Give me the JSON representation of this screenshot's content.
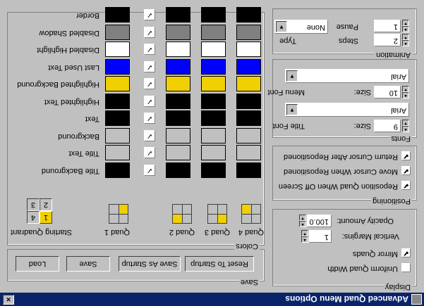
{
  "window": {
    "title": "Advanced Quad Menu Options",
    "close_label": "×"
  },
  "display": {
    "legend": "Display",
    "uniform_quad_width": {
      "label": "Uniform Quad Width",
      "checked": false
    },
    "mirror_quads": {
      "label": "Mirror Quads",
      "checked": true
    },
    "vertical_margins": {
      "label": "Vertical Margins:",
      "value": "1"
    },
    "opacity_amount": {
      "label": "Opacity Amount:",
      "value": "100.0"
    }
  },
  "positioning": {
    "legend": "Positioning",
    "items": [
      {
        "label": "Reposition Quad When Off Screen",
        "checked": true
      },
      {
        "label": "Move Cursor When Repositioned",
        "checked": true
      },
      {
        "label": "Return Cursor After Repositioned",
        "checked": true
      }
    ]
  },
  "fonts": {
    "legend": "Fonts",
    "title_font": {
      "label": "Title Font",
      "value": "Arial",
      "size_label": "Size:",
      "size": "9"
    },
    "menu_font": {
      "label": "Menu Font",
      "value": "Arial",
      "size_label": "Size:",
      "size": "10"
    }
  },
  "animation": {
    "legend": "Animation",
    "type": {
      "label": "Type",
      "value": "None"
    },
    "steps": {
      "label": "Steps",
      "value": "2"
    },
    "pause": {
      "label": "Pause",
      "value": "1"
    }
  },
  "save": {
    "legend": "Save",
    "buttons": [
      "Load",
      "Save",
      "Save As Startup",
      "Reset To Startup"
    ]
  },
  "colors": {
    "legend": "Colors",
    "starting_quadrant_label": "Starting Quadrant",
    "quadrant_numbers": [
      "4",
      "1",
      "3",
      "2"
    ],
    "selected_quadrant": "1",
    "quad_labels": [
      "Quad 1",
      "Quad 2",
      "Quad 3",
      "Quad 4"
    ],
    "rows": [
      {
        "label": "Title Background",
        "swatch_color": "#000000",
        "checked": true
      },
      {
        "label": "Title Text",
        "swatch_color": "#c0c0c0",
        "checked": true
      },
      {
        "label": "Background",
        "swatch_color": "#c0c0c0",
        "checked": true
      },
      {
        "label": "Text",
        "swatch_color": "#000000",
        "checked": true
      },
      {
        "label": "Highlighted Text",
        "swatch_color": "#000000",
        "checked": true
      },
      {
        "label": "Highlighted Background",
        "swatch_color": "#f0d000",
        "checked": true
      },
      {
        "label": "Last Used Text",
        "swatch_color": "#0000ff",
        "checked": true
      },
      {
        "label": "Disabled Highlight",
        "swatch_color": "#ffffff",
        "checked": true
      },
      {
        "label": "Disabled Shadow",
        "swatch_color": "#808080",
        "checked": true
      },
      {
        "label": "Border",
        "swatch_color": "#000000",
        "checked": true
      }
    ]
  }
}
